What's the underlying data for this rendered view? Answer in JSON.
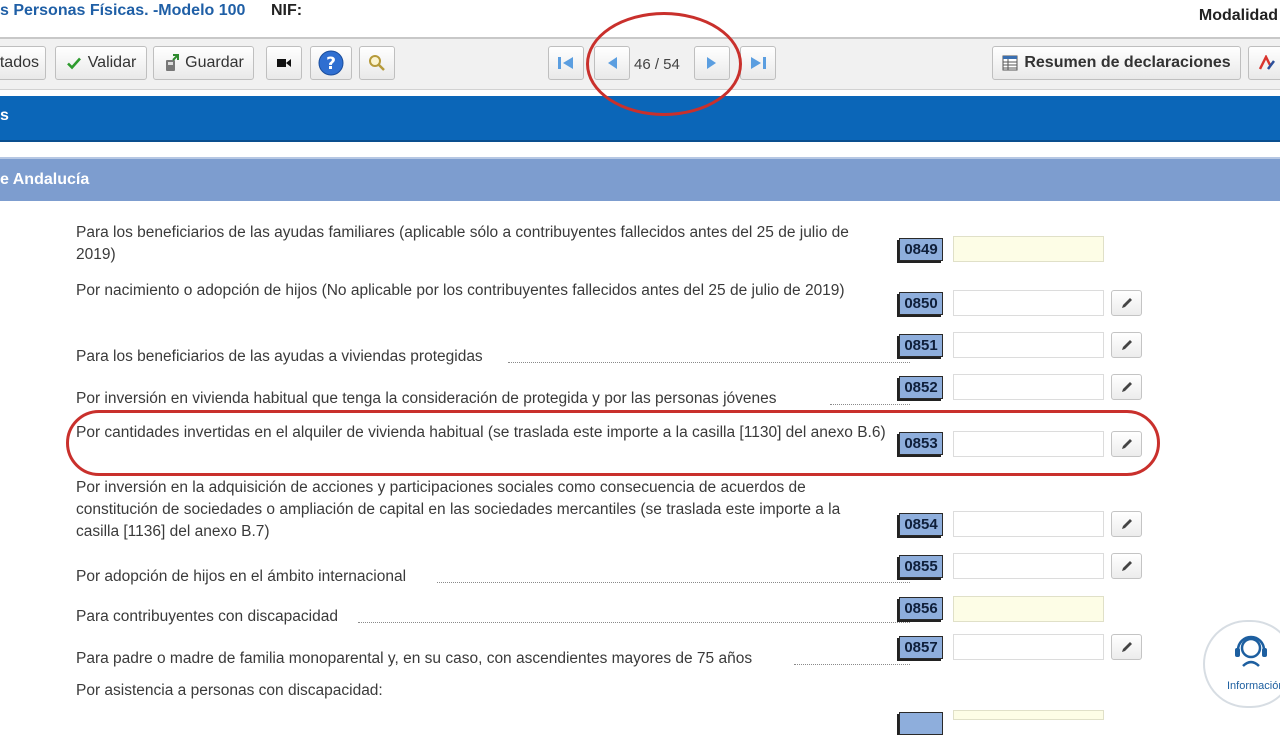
{
  "header": {
    "title": "s Personas Físicas. -Modelo 100",
    "nif_label": "NIF:",
    "modalidad_label": "Modalidad"
  },
  "toolbar": {
    "cut_button_label": "tados",
    "validate_label": "Validar",
    "save_label": "Guardar",
    "page_indicator": "46 / 54",
    "summary_label": "Resumen de declaraciones"
  },
  "section": {
    "band_text": "s",
    "subsection_title": "e Andalucía"
  },
  "rows": [
    {
      "label": "Para los beneficiarios de las ayudas familiares (aplicable sólo a contribuyentes fallecidos antes del 25 de julio de 2019)",
      "code": "0849"
    },
    {
      "label": "Por nacimiento o adopción de hijos (No aplicable por los contribuyentes fallecidos antes del 25 de julio de 2019)",
      "code": "0850"
    },
    {
      "label": "Para los beneficiarios de las ayudas a viviendas protegidas",
      "code": "0851"
    },
    {
      "label": "Por inversión en vivienda habitual que tenga la consideración de protegida y por las personas jóvenes",
      "code": "0852"
    },
    {
      "label": "Por cantidades invertidas en el alquiler de vivienda habitual (se traslada este importe a la casilla [1130] del anexo B.6)",
      "code": "0853"
    },
    {
      "label": "Por inversión en la adquisición de acciones y participaciones sociales como consecuencia de acuerdos de constitución de sociedades o ampliación de capital en las sociedades mercantiles (se traslada este importe a la casilla [1136] del anexo B.7)",
      "code": "0854"
    },
    {
      "label": "Por adopción de hijos en el ámbito internacional",
      "code": "0855"
    },
    {
      "label": "Para contribuyentes con discapacidad",
      "code": "0856"
    },
    {
      "label": "Para padre o madre de familia monoparental y, en su caso, con ascendientes mayores de 75 años",
      "code": "0857"
    },
    {
      "label": "Por asistencia a personas con discapacidad:",
      "code": ""
    }
  ],
  "info_widget": {
    "label": "Información"
  },
  "colors": {
    "accent_blue": "#0b66b8",
    "section_blue": "#7d9dcf",
    "code_badge": "#8eaedc",
    "highlight_red": "#c9302c",
    "readonly_field": "#fdfde6"
  },
  "icons": [
    "checkmark-icon",
    "save-icon",
    "video-icon",
    "help-icon",
    "search-icon",
    "first-page-icon",
    "prev-page-icon",
    "next-page-icon",
    "last-page-icon",
    "table-icon",
    "pencil-icon",
    "headset-icon"
  ]
}
